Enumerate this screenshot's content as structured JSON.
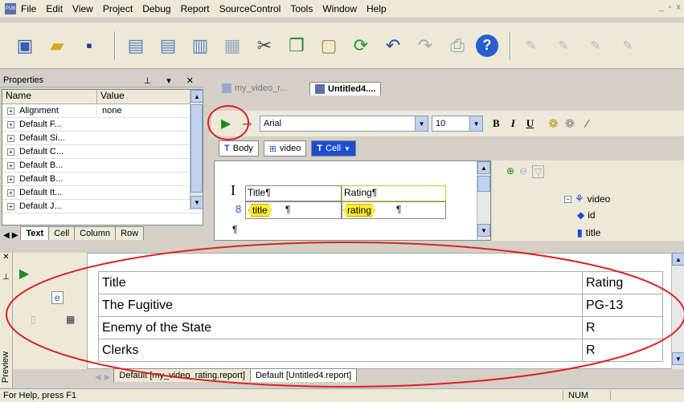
{
  "menu": {
    "items": [
      "File",
      "Edit",
      "View",
      "Project",
      "Debug",
      "Report",
      "SourceControl",
      "Tools",
      "Window",
      "Help"
    ],
    "window_controls": {
      "minimize": "_",
      "restore": "▫",
      "close": "x"
    }
  },
  "properties": {
    "title": "Properties",
    "pin_icon": "pin-icon",
    "col_name": "Name",
    "col_value": "Value",
    "rows": [
      {
        "name": "Alignment",
        "value": "none"
      },
      {
        "name": "Default F...",
        "value": ""
      },
      {
        "name": "Default Si...",
        "value": ""
      },
      {
        "name": "Default C...",
        "value": ""
      },
      {
        "name": "Default B...",
        "value": ""
      },
      {
        "name": "Default B...",
        "value": ""
      },
      {
        "name": "Default It...",
        "value": ""
      },
      {
        "name": "Default J...",
        "value": ""
      }
    ],
    "tabs": [
      "Text",
      "Cell",
      "Column",
      "Row"
    ]
  },
  "doc_tabs": {
    "inactive": "my_video_r...",
    "active": "Untitled4...."
  },
  "format_bar": {
    "font": "Arial",
    "size": "10",
    "bold": "B",
    "italic": "I",
    "underline": "U"
  },
  "breadcrumb": {
    "body": "Body",
    "video": "video",
    "cell": "Cell"
  },
  "designer": {
    "header_title": "Title¶",
    "header_rating": "Rating¶",
    "field_title": "title",
    "field_rating": "rating",
    "pilcrow": "¶",
    "cursor": "I",
    "link_glyph": "8"
  },
  "tree": {
    "root": "video",
    "children": [
      "id",
      "title"
    ]
  },
  "preview": {
    "side_label": "Preview",
    "rows": [
      {
        "title": "Title",
        "rating": "Rating"
      },
      {
        "title": "The Fugitive",
        "rating": "PG-13"
      },
      {
        "title": "Enemy of the State",
        "rating": "R"
      },
      {
        "title": "Clerks",
        "rating": "R"
      }
    ],
    "tabs": [
      "Default [my_video_rating.report]",
      "Default [Untitled4.report]"
    ]
  },
  "status": {
    "help": "For Help, press F1",
    "num": "NUM"
  },
  "colors": {
    "annotation_red": "#e02020",
    "play_green": "#1a8a1a",
    "tab_blue": "#1c4fd0"
  }
}
